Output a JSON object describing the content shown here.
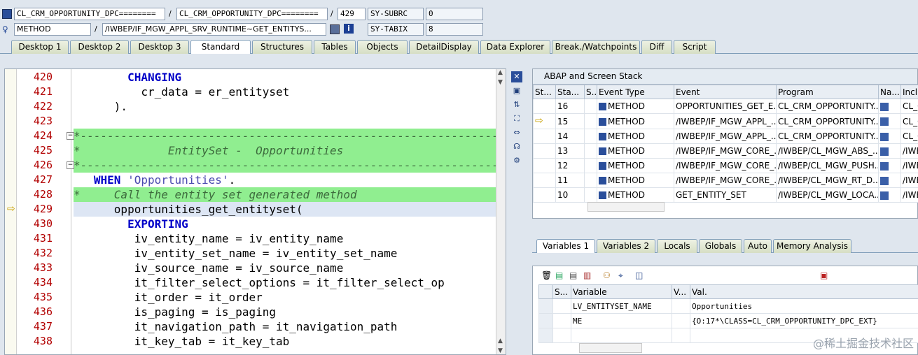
{
  "header": {
    "program1": "CL_CRM_OPPORTUNITY_DPC========",
    "program2": "CL_CRM_OPPORTUNITY_DPC========",
    "line": "429",
    "sysfield1_name": "SY-SUBRC",
    "sysfield1_value": "0",
    "event_type": "METHOD",
    "event": "/IWBEP/IF_MGW_APPL_SRV_RUNTIME~GET_ENTITYS...",
    "sysfield2_name": "SY-TABIX",
    "sysfield2_value": "8",
    "sep": "/"
  },
  "tabs": [
    "Desktop 1",
    "Desktop 2",
    "Desktop 3",
    "Standard",
    "Structures",
    "Tables",
    "Objects",
    "DetailDisplay",
    "Data Explorer",
    "Break./Watchpoints",
    "Diff",
    "Script"
  ],
  "active_tab": "Standard",
  "editor": {
    "lines": [
      {
        "num": "420",
        "indent": "        ",
        "parts": [
          {
            "t": "CHANGING",
            "c": "kw"
          }
        ]
      },
      {
        "num": "421",
        "indent": "          ",
        "parts": [
          {
            "t": "cr_data = er_entityset",
            "c": "ident"
          }
        ]
      },
      {
        "num": "422",
        "indent": "      ",
        "parts": [
          {
            "t": ").",
            "c": "ident"
          }
        ]
      },
      {
        "num": "423",
        "indent": "",
        "parts": []
      },
      {
        "num": "424",
        "indent": "",
        "parts": [
          {
            "t": "*-------------------------------------------------------------------",
            "c": "cm"
          }
        ],
        "hl": true
      },
      {
        "num": "425",
        "indent": "",
        "parts": [
          {
            "t": "*             EntitySet -  Opportunities",
            "c": "cm"
          }
        ],
        "hl": true
      },
      {
        "num": "426",
        "indent": "",
        "parts": [
          {
            "t": "*-------------------------------------------------------------------",
            "c": "cm"
          }
        ],
        "hl": true
      },
      {
        "num": "427",
        "indent": "   ",
        "parts": [
          {
            "t": "WHEN ",
            "c": "kw"
          },
          {
            "t": "'Opportunities'",
            "c": "str"
          },
          {
            "t": ".",
            "c": "ident"
          }
        ]
      },
      {
        "num": "428",
        "indent": "",
        "parts": [
          {
            "t": "*     Call the entity set generated method",
            "c": "cm"
          }
        ],
        "hl": true
      },
      {
        "num": "429",
        "indent": "      ",
        "parts": [
          {
            "t": "opportunities_get_entityset(",
            "c": "ident"
          }
        ],
        "current": true
      },
      {
        "num": "430",
        "indent": "        ",
        "parts": [
          {
            "t": "EXPORTING",
            "c": "kw"
          }
        ]
      },
      {
        "num": "431",
        "indent": "         ",
        "parts": [
          {
            "t": "iv_entity_name = iv_entity_name",
            "c": "ident"
          }
        ]
      },
      {
        "num": "432",
        "indent": "         ",
        "parts": [
          {
            "t": "iv_entity_set_name = iv_entity_set_name",
            "c": "ident"
          }
        ]
      },
      {
        "num": "433",
        "indent": "         ",
        "parts": [
          {
            "t": "iv_source_name = iv_source_name",
            "c": "ident"
          }
        ]
      },
      {
        "num": "434",
        "indent": "         ",
        "parts": [
          {
            "t": "it_filter_select_options = it_filter_select_op",
            "c": "ident"
          }
        ]
      },
      {
        "num": "435",
        "indent": "         ",
        "parts": [
          {
            "t": "it_order = it_order",
            "c": "ident"
          }
        ]
      },
      {
        "num": "436",
        "indent": "         ",
        "parts": [
          {
            "t": "is_paging = is_paging",
            "c": "ident"
          }
        ]
      },
      {
        "num": "437",
        "indent": "         ",
        "parts": [
          {
            "t": "it_navigation_path = it_navigation_path",
            "c": "ident"
          }
        ]
      },
      {
        "num": "438",
        "indent": "         ",
        "parts": [
          {
            "t": "it_key_tab = it_key_tab",
            "c": "ident"
          }
        ]
      }
    ]
  },
  "stack": {
    "title": "ABAP and Screen Stack",
    "columns": [
      "St...",
      "Sta...",
      "S..",
      "Event Type",
      "Event",
      "Program",
      "Na...",
      "Inclu"
    ],
    "rows": [
      {
        "level": "16",
        "type": "METHOD",
        "event": "OPPORTUNITIES_GET_E...",
        "program": "CL_CRM_OPPORTUNITY...",
        "incl": "CL_C",
        "current": false
      },
      {
        "level": "15",
        "type": "METHOD",
        "event": "/IWBEP/IF_MGW_APPL_...",
        "program": "CL_CRM_OPPORTUNITY...",
        "incl": "CL_C",
        "current": true
      },
      {
        "level": "14",
        "type": "METHOD",
        "event": "/IWBEP/IF_MGW_APPL_...",
        "program": "CL_CRM_OPPORTUNITY...",
        "incl": "CL_C",
        "current": false
      },
      {
        "level": "13",
        "type": "METHOD",
        "event": "/IWBEP/IF_MGW_CORE_...",
        "program": "/IWBEP/CL_MGW_ABS_...",
        "incl": "/IWB",
        "current": false
      },
      {
        "level": "12",
        "type": "METHOD",
        "event": "/IWBEP/IF_MGW_CORE_...",
        "program": "/IWBEP/CL_MGW_PUSH...",
        "incl": "/IWB",
        "current": false
      },
      {
        "level": "11",
        "type": "METHOD",
        "event": "/IWBEP/IF_MGW_CORE_...",
        "program": "/IWBEP/CL_MGW_RT_D...",
        "incl": "/IWB",
        "current": false
      },
      {
        "level": "10",
        "type": "METHOD",
        "event": "GET_ENTITY_SET",
        "program": "/IWBEP/CL_MGW_LOCA...",
        "incl": "/IWB",
        "current": false
      }
    ]
  },
  "var_tabs": [
    "Variables 1",
    "Variables 2",
    "Locals",
    "Globals",
    "Auto",
    "Memory Analysis"
  ],
  "active_var_tab": "Variables 1",
  "vars": {
    "columns": [
      "S...",
      "Variable",
      "V...",
      "Val."
    ],
    "rows": [
      {
        "name": "LV_ENTITYSET_NAME",
        "value": "Opportunities"
      },
      {
        "name": "ME",
        "value": "{O:17*\\CLASS=CL_CRM_OPPORTUNITY_DPC_EXT}"
      }
    ]
  },
  "watermark": "@稀土掘金技术社区",
  "colors": {
    "highlight": "#90ee90",
    "current_line": "#dde6f4",
    "line_num": "#b20000",
    "keyword": "#0000c8"
  }
}
